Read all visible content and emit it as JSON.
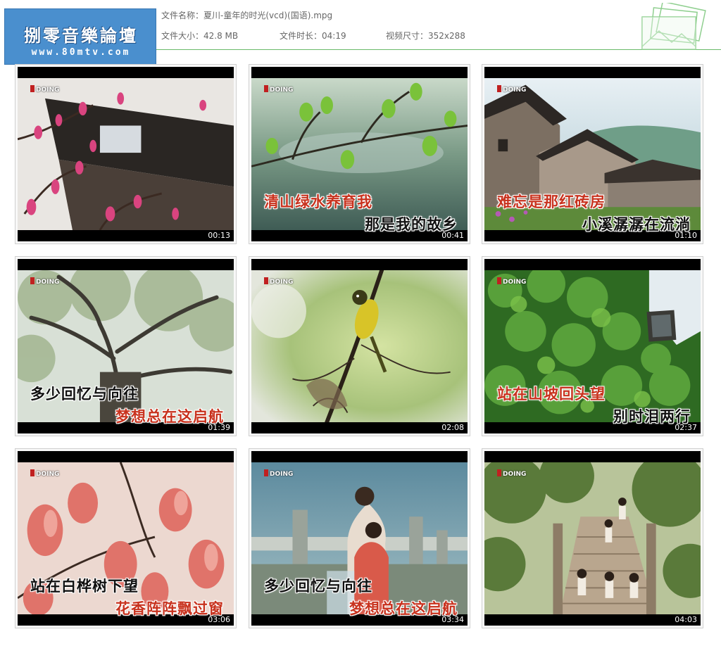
{
  "header": {
    "logo_title": "捌零音樂論壇",
    "logo_url": "www.80mtv.com",
    "filename_label": "文件名称：夏川-童年的时光(vcd)(国语).mpg",
    "size_label": "文件大小：42.8 MB",
    "duration_label": "文件时长：04:19",
    "dims_label": "视频尺寸：352x288"
  },
  "watermark": "DOING",
  "colors": {
    "lyric_red": "#c8321e",
    "lyric_black": "#111111",
    "header_rule": "#6aba6a",
    "logo_blue": "#4a8fce"
  },
  "thumbnails": [
    {
      "time": "00:13",
      "line1": "",
      "line2": "",
      "scene": "magnolia-eaves"
    },
    {
      "time": "00:41",
      "line1": "清山绿水养育我",
      "line2": "那是我的故乡",
      "scene": "green-branch"
    },
    {
      "time": "01:10",
      "line1": "难忘是那红砖房",
      "line2": "小溪潺潺在流淌",
      "scene": "village-houses"
    },
    {
      "time": "01:39",
      "line1": "多少回忆与向往",
      "line2": "梦想总在这启航",
      "scene": "big-tree"
    },
    {
      "time": "02:08",
      "line1": "",
      "line2": "",
      "scene": "yellow-bird"
    },
    {
      "time": "02:37",
      "line1": "站在山坡回头望",
      "line2": "别时泪两行",
      "scene": "ivy-wall"
    },
    {
      "time": "03:06",
      "line1": "站在白桦树下望",
      "line2": "花香阵阵飘过窗",
      "scene": "pink-magnolia"
    },
    {
      "time": "03:34",
      "line1": "多少回忆与向往",
      "line2": "梦想总在这启航",
      "scene": "girls-bridge"
    },
    {
      "time": "04:03",
      "line1": "",
      "line2": "",
      "scene": "stone-steps"
    }
  ]
}
